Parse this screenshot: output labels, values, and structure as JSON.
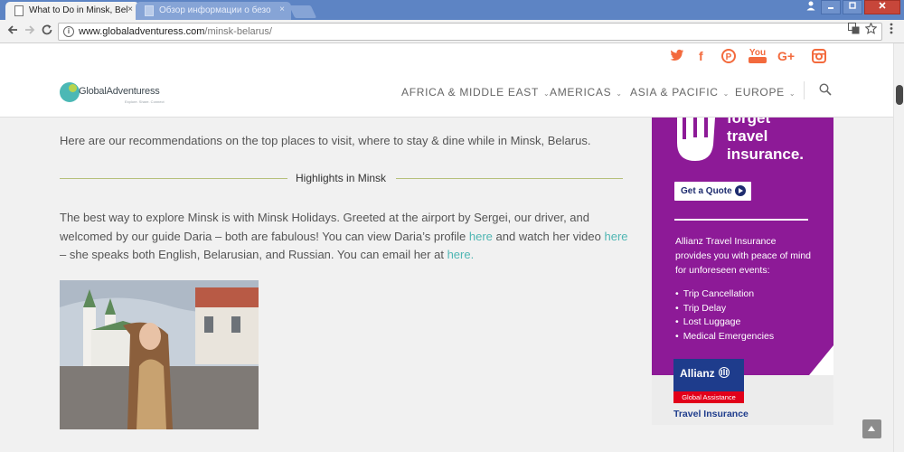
{
  "browser": {
    "active_tab_title": "What to Do in Minsk, Bel",
    "inactive_tab_title": "Обзор информации о безо",
    "tab_close_glyph": "×",
    "url_host": "www.globaladventuress.com",
    "url_path": "/minsk-belarus/"
  },
  "site": {
    "logo_name": "GlobalAdventuress",
    "logo_tagline": "Explore. Share. Connect",
    "social_icons": [
      "twitter-icon",
      "facebook-icon",
      "pinterest-icon",
      "youtube-icon",
      "google-plus-icon",
      "instagram-icon"
    ],
    "social_glyphs": {
      "twitter": "🐦",
      "facebook": "f",
      "pinterest": "P",
      "youtube": "You",
      "google_plus": "G+",
      "instagram": "◘"
    },
    "menu": [
      "AFRICA & MIDDLE EAST",
      "AMERICAS",
      "ASIA & PACIFIC",
      "EUROPE"
    ],
    "accent_color": "#f36a3d",
    "link_color": "#4fb6b3"
  },
  "article": {
    "intro": "Here are our recommendations on the top places to visit, where to stay & dine while in Minsk, Belarus.",
    "section_title": "Highlights in Minsk",
    "body_1": "The best way to explore Minsk is with Minsk Holidays.  Greeted at the airport by Sergei, our driver, and welcomed by our guide Daria – both are fabulous!  You can view Daria’s profile ",
    "link_1": "here",
    "body_2": "  and watch her video ",
    "link_2": "here",
    "body_3": " – she speaks both English, Belarusian, and Russian.  You can email her at ",
    "link_3": "here."
  },
  "ad": {
    "headline_1": "forget",
    "headline_2": "travel",
    "headline_3": "insurance.",
    "cta": "Get a Quote",
    "copy": "Allianz Travel Insurance provides you with peace of mind for unforeseen events:",
    "benefits": [
      "Trip Cancellation",
      "Trip Delay",
      "Lost Luggage",
      "Medical Emergencies"
    ],
    "brand": "Allianz",
    "brand_sub": "Global Assistance",
    "brand_product": "Travel Insurance",
    "purple": "#8d1a97"
  }
}
